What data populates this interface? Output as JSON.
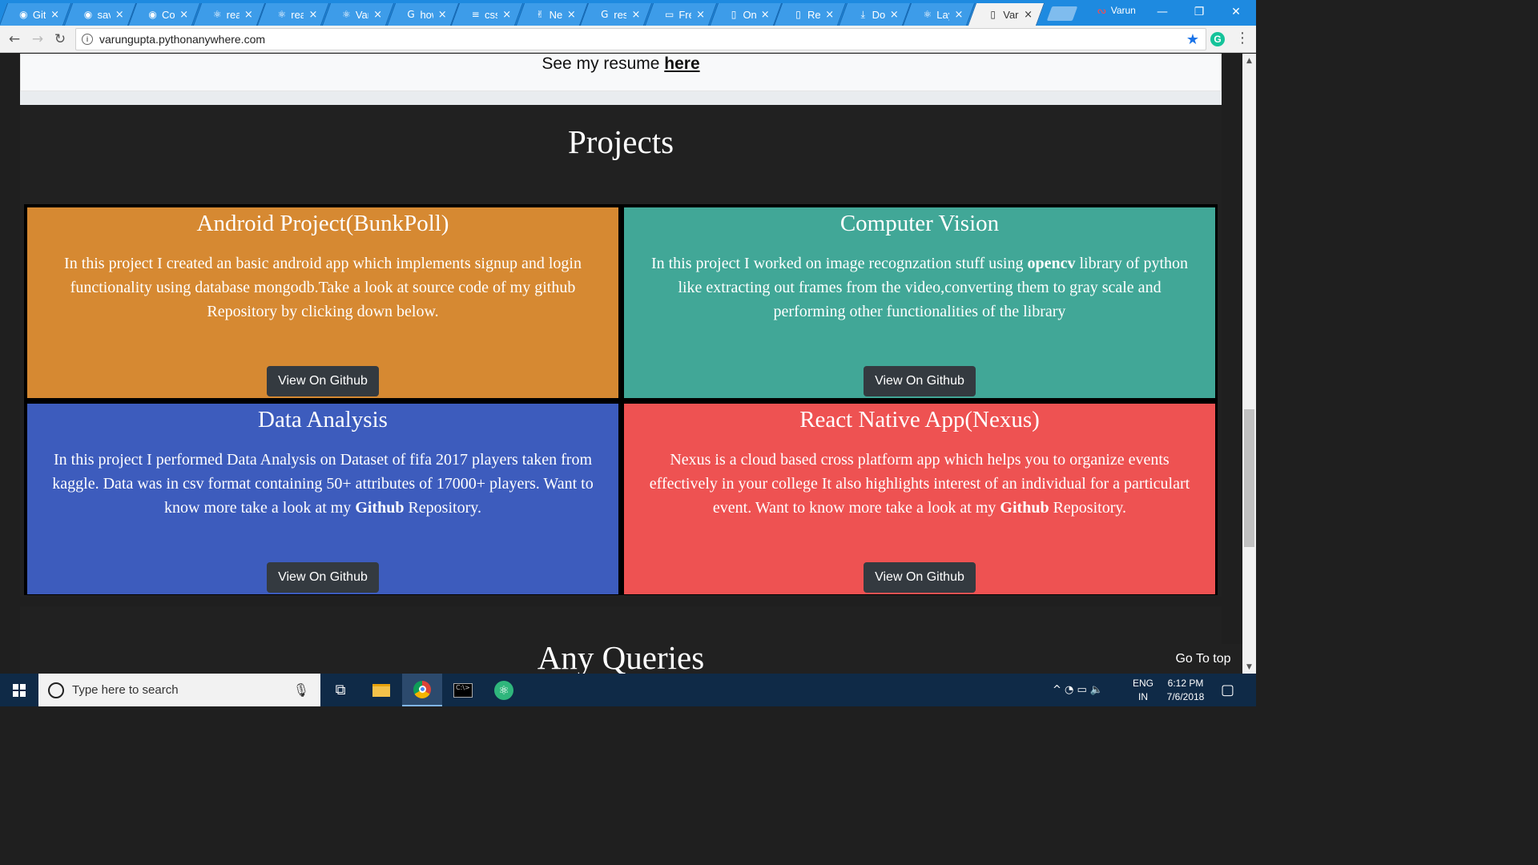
{
  "browser": {
    "tabs": [
      {
        "label": "Github",
        "icon": "github-icon",
        "glyph": "◉"
      },
      {
        "label": "saved",
        "icon": "github-icon",
        "glyph": "◉"
      },
      {
        "label": "Con",
        "icon": "github-icon",
        "glyph": "◉"
      },
      {
        "label": "react",
        "icon": "react-icon",
        "glyph": "⚛"
      },
      {
        "label": "react",
        "icon": "react-icon",
        "glyph": "⚛"
      },
      {
        "label": "Varun",
        "icon": "react-dark-icon",
        "glyph": "⚛"
      },
      {
        "label": "how",
        "icon": "google-icon",
        "glyph": "G"
      },
      {
        "label": "css",
        "icon": "stackoverflow-icon",
        "glyph": "≡"
      },
      {
        "label": "Nexus",
        "icon": "peace-icon",
        "glyph": "✌"
      },
      {
        "label": "resize",
        "icon": "google-icon",
        "glyph": "G"
      },
      {
        "label": "Free",
        "icon": "folder-icon",
        "glyph": "▭"
      },
      {
        "label": "Online",
        "icon": "document-icon",
        "glyph": "▯"
      },
      {
        "label": "Resume",
        "icon": "document-icon",
        "glyph": "▯"
      },
      {
        "label": "Download",
        "icon": "download-icon",
        "glyph": "⤓"
      },
      {
        "label": "Layout",
        "icon": "react-dark-icon",
        "glyph": "⚛"
      },
      {
        "label": "Varun",
        "icon": "document-icon",
        "glyph": "▯",
        "active": true
      }
    ],
    "close_glyph": "×",
    "profile_name": "Varun",
    "url": "varungupta.pythonanywhere.com",
    "info_glyph": "i",
    "star_glyph": "★",
    "ext_letter": "G",
    "menu_glyph": "⋮",
    "back_glyph": "←",
    "forward_glyph": "→",
    "reload_glyph": "↻",
    "minimize_glyph": "—",
    "restore_glyph": "❐",
    "close_window_glyph": "✕",
    "profile_glyph": "ᔓ"
  },
  "page": {
    "resume_prefix": "See my resume ",
    "resume_link": "here",
    "projects_title": "Projects",
    "projects": [
      {
        "title": "Android Project(BunkPoll)",
        "desc_html": "In this project I created an basic android app which implements signup and login functionality using database mongodb.Take a look at source code of my github Repository by clicking down below.",
        "button": "View On Github",
        "color": "#d68932"
      },
      {
        "title": "Computer Vision",
        "desc_pre": "In this project I worked on image recognzation stuff using ",
        "desc_bold": "opencv",
        "desc_post": " library of python like extracting out frames from the video,converting them to gray scale and performing other functionalities of the library",
        "button": "View On Github",
        "color": "#41a797"
      },
      {
        "title": "Data Analysis",
        "desc_pre": "In this project I performed Data Analysis on Dataset of fifa 2017 players taken from kaggle. Data was in csv format containing 50+ attributes of 17000+ players. Want to know more take a look at my ",
        "desc_bold": "Github",
        "desc_post": " Repository.",
        "button": "View On Github",
        "color": "#3d5cbd"
      },
      {
        "title": "React Native App(Nexus)",
        "desc_pre": "Nexus is a cloud based cross platform app which helps you to organize events effectively in your college It also highlights interest of an individual for a particulart event. Want to know more take a look at my ",
        "desc_bold": "Github",
        "desc_post": " Repository.",
        "button": "View On Github",
        "color": "#ee5252"
      }
    ],
    "queries_title": "Any Queries",
    "go_to_top": "Go To top"
  },
  "scrollbar": {
    "up_glyph": "▲",
    "down_glyph": "▼"
  },
  "taskbar": {
    "search_placeholder": "Type here to search",
    "mic_glyph": "🎙",
    "taskview_glyph": "⧉",
    "tray_glyphs": "^ ◔ ▭ 🔈",
    "lang": "ENG",
    "region": "IN",
    "time": "6:12 PM",
    "date": "7/6/2018",
    "notification_glyph": "▢",
    "cmd_text": "C:\\>",
    "atom_glyph": "⚛"
  }
}
